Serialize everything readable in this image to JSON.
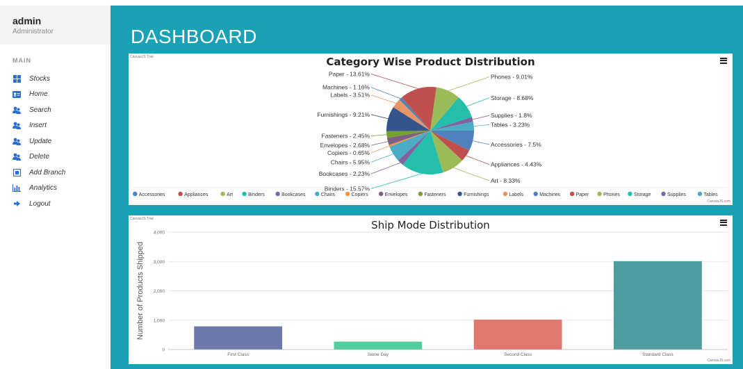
{
  "user": {
    "name": "admin",
    "role": "Administrator"
  },
  "sidebar": {
    "section": "MAIN",
    "items": [
      {
        "label": "Stocks",
        "icon": "grid-icon"
      },
      {
        "label": "Home",
        "icon": "id-card-icon"
      },
      {
        "label": "Search",
        "icon": "users-icon"
      },
      {
        "label": "Insert",
        "icon": "users-icon"
      },
      {
        "label": "Update",
        "icon": "users-icon"
      },
      {
        "label": "Delete",
        "icon": "users-icon"
      },
      {
        "label": "Add Branch",
        "icon": "box-icon"
      },
      {
        "label": "Analytics",
        "icon": "bar-chart-icon"
      },
      {
        "label": "Logout",
        "icon": "sign-out-icon"
      }
    ]
  },
  "page": {
    "title": "DASHBOARD"
  },
  "canvas_trial": "CanvasJS Trial",
  "canvas_credit": "CanvasJS.com",
  "colors": {
    "accent": "#1aa1b6"
  },
  "chart_data": [
    {
      "type": "pie",
      "title": "Category Wise Product Distribution",
      "slices": [
        {
          "name": "Accessories",
          "value": 7.5,
          "label": "Accessories - 7.5%",
          "color": "#4f81bc"
        },
        {
          "name": "Appliances",
          "value": 4.43,
          "label": "Appliances - 4.43%",
          "color": "#c0504e"
        },
        {
          "name": "Art",
          "value": 8.33,
          "label": "Art - 8.33%",
          "color": "#9bbb58"
        },
        {
          "name": "Binders",
          "value": 15.57,
          "label": "Binders - 15.57%",
          "color": "#23bfaa"
        },
        {
          "name": "Bookcases",
          "value": 2.23,
          "label": "Bookcases - 2.23%",
          "color": "#8064a1"
        },
        {
          "name": "Chairs",
          "value": 5.95,
          "label": "Chairs - 5.95%",
          "color": "#4aacc5"
        },
        {
          "name": "Copiers",
          "value": 0.65,
          "label": "Copiers - 0.65%",
          "color": "#f79647"
        },
        {
          "name": "Envelopes",
          "value": 2.68,
          "label": "Envelopes - 2.68%",
          "color": "#7f6084"
        },
        {
          "name": "Fasteners",
          "value": 2.45,
          "label": "Fasteners - 2.45%",
          "color": "#77a033"
        },
        {
          "name": "Furnishings",
          "value": 9.21,
          "label": "Furnishings - 9.21%",
          "color": "#33558b"
        },
        {
          "name": "Labels",
          "value": 3.51,
          "label": "Labels - 3.51%",
          "color": "#e59566"
        },
        {
          "name": "Machines",
          "value": 1.16,
          "label": "Machines - 1.16%",
          "color": "#4f81bc"
        },
        {
          "name": "Paper",
          "value": 13.61,
          "label": "Paper - 13.61%",
          "color": "#c0504e"
        },
        {
          "name": "Phones",
          "value": 9.01,
          "label": "Phones - 9.01%",
          "color": "#9bbb58"
        },
        {
          "name": "Storage",
          "value": 8.68,
          "label": "Storage - 8.68%",
          "color": "#23bfaa"
        },
        {
          "name": "Supplies",
          "value": 1.8,
          "label": "Supplies - 1.8%",
          "color": "#8064a1"
        },
        {
          "name": "Tables",
          "value": 3.23,
          "label": "Tables - 3.23%",
          "color": "#4aacc5"
        }
      ],
      "legend": "bottom"
    },
    {
      "type": "bar",
      "title": "Ship Mode Distribution",
      "ylabel": "Number of Products Shipped",
      "categories": [
        "First Class",
        "Same Day",
        "Second Class",
        "Standard Class"
      ],
      "values": [
        790,
        270,
        1020,
        3010
      ],
      "colors": [
        "#6d78ad",
        "#51cda0",
        "#df7970",
        "#4c9ca0"
      ],
      "ylim": [
        0,
        4000
      ],
      "yticks": [
        "0",
        "1,000",
        "2,000",
        "3,000",
        "4,000"
      ],
      "grid": true
    }
  ]
}
